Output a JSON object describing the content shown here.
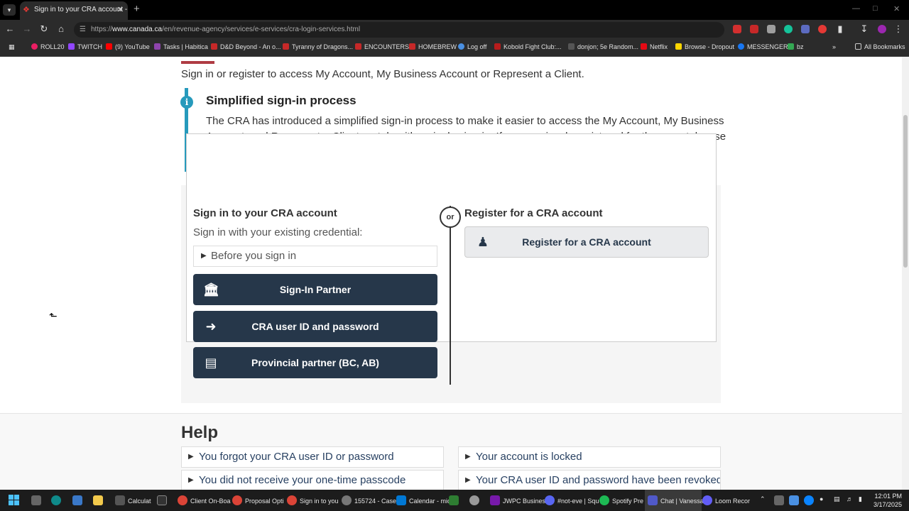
{
  "browser": {
    "tab_title": "Sign in to your CRA account - C",
    "url_host": "www.canada.ca",
    "url_prefix": "https://",
    "url_path": "/en/revenue-agency/services/e-services/cra-login-services.html",
    "bookmarks": [
      "ROLL20",
      "TWITCH",
      "(9) YouTube",
      "Tasks | Habitica",
      "D&D Beyond - An o...",
      "Tyranny of Dragons...",
      "ENCOUNTERS",
      "HOMEBREW",
      "Log off",
      "Kobold Fight Club:...",
      "donjon; 5e Random...",
      "Netflix",
      "Browse - Dropout",
      "MESSENGER",
      "bz"
    ],
    "all_bookmarks": "All Bookmarks"
  },
  "page": {
    "intro": "Sign in or register to access My Account, My Business Account or Represent a Client.",
    "notice": {
      "title": "Simplified sign-in process",
      "body": "The CRA has introduced a simplified sign-in process to make it easier to access the My Account, My Business Account, and Represent a Client portals with a single sign-in. If you previously registered for these portals, use your existing credentials and select a sign-in option below to access your CRA account."
    },
    "signin": {
      "title": "Sign in to your CRA account",
      "subtitle": "Sign in with your existing credential:",
      "details": "Before you sign in",
      "buttons": [
        "Sign-In Partner",
        "CRA user ID and password",
        "Provincial partner (BC, AB)"
      ]
    },
    "or": "or",
    "register": {
      "title": "Register for a CRA account",
      "button": "Register for a CRA account"
    },
    "help": {
      "title": "Help",
      "items": [
        "You forgot your CRA user ID or password",
        "Your account is locked",
        "You did not receive your one-time passcode",
        "Your CRA user ID and password have been revoked"
      ]
    }
  },
  "taskbar": {
    "items": [
      "Calculat",
      "Client On-Boa",
      "Proposal Opti",
      "Sign in to you",
      "155724 - Case",
      "Calendar - mic",
      "JWPC Busines",
      "#not-eve | Squ",
      "Spotify Pre",
      "Chat | Vanessa",
      "Loom Recor"
    ],
    "time": "12:01 PM",
    "date": "3/17/2025"
  },
  "colors": {
    "accent_navy": "#26374a",
    "info_blue": "#269abc",
    "canada_red": "#af3c43"
  }
}
